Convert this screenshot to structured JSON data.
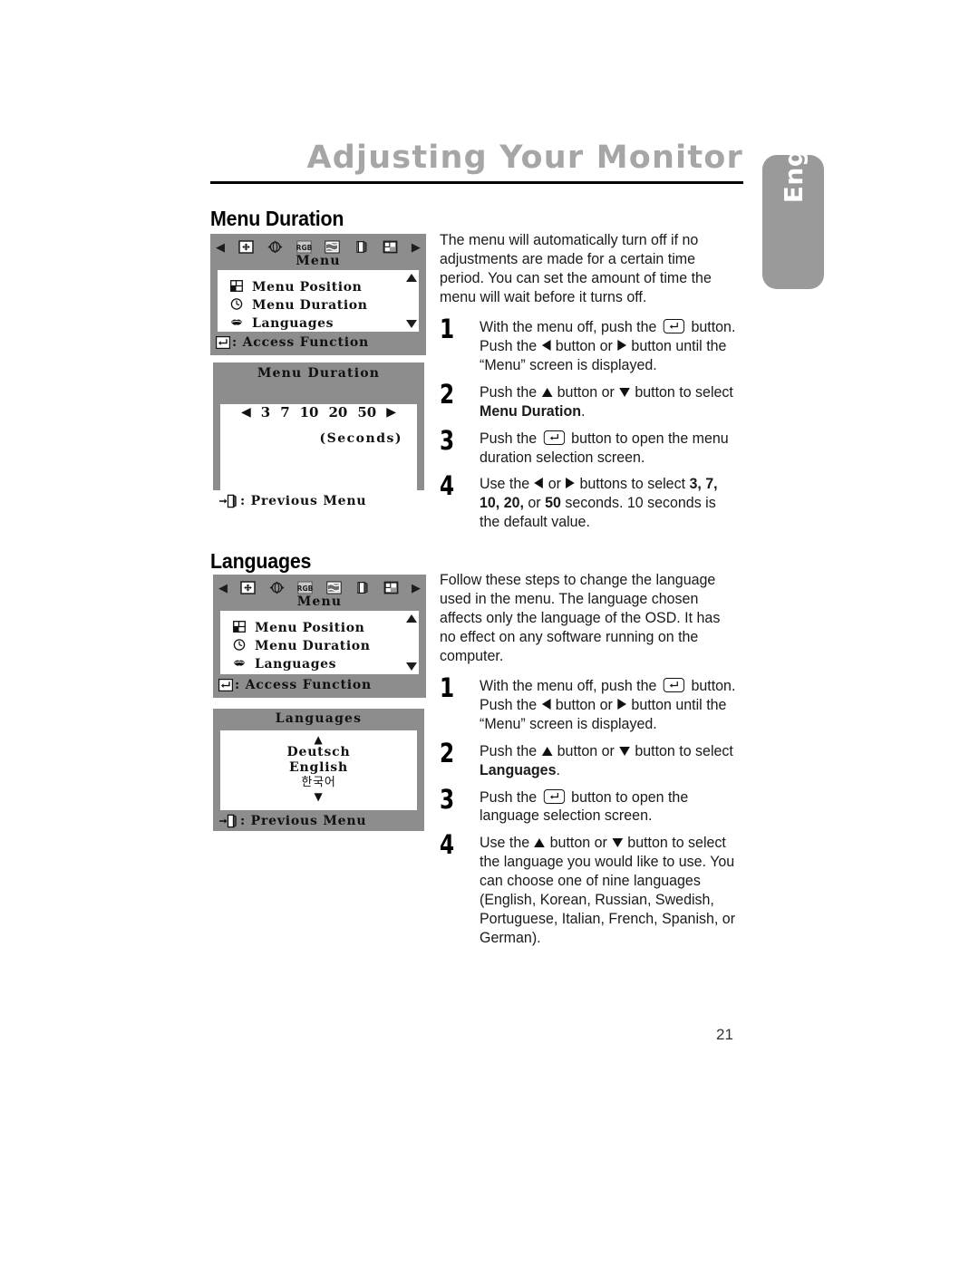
{
  "page": {
    "title": "Adjusting Your Monitor",
    "side_tab": "English",
    "number": "21"
  },
  "sections": [
    {
      "heading": "Menu Duration",
      "intro": "The menu will automatically turn off if no adjustments are made for a certain time period. You can set the amount of time the menu will wait before it turns off.",
      "steps": [
        {
          "num": "1",
          "text_parts": [
            "With the menu off, push the ",
            "ENTER",
            " button. Push the ",
            "LEFT",
            " button or ",
            "RIGHT",
            " button until the “Menu” screen is displayed."
          ]
        },
        {
          "num": "2",
          "text_parts": [
            "Push the ",
            "UP",
            " button or ",
            "DOWN",
            " button to select ",
            "BOLD:Menu Duration",
            "."
          ]
        },
        {
          "num": "3",
          "text_parts": [
            "Push the ",
            "ENTER",
            " button to open the menu duration selection screen."
          ]
        },
        {
          "num": "4",
          "text_parts": [
            "Use the ",
            "LEFT",
            " or ",
            "RIGHT",
            " buttons to select ",
            "BOLD:3, 7, 10, 20,",
            " or ",
            "BOLD:50",
            " seconds. 10 seconds is the default value."
          ]
        }
      ]
    },
    {
      "heading": "Languages",
      "intro": "Follow these steps to change the language used in the menu. The language chosen affects only the language of the OSD. It has no effect on any software running on the computer.",
      "steps": [
        {
          "num": "1",
          "text_parts": [
            "With the menu off, push the ",
            "ENTER",
            " button. Push the ",
            "LEFT",
            " button or ",
            "RIGHT",
            " button until the “Menu” screen is displayed."
          ]
        },
        {
          "num": "2",
          "text_parts": [
            "Push the ",
            "UP",
            " button or ",
            "DOWN",
            " button to select ",
            "BOLD:Languages",
            "."
          ]
        },
        {
          "num": "3",
          "text_parts": [
            "Push the ",
            "ENTER",
            " button to open the language selection screen."
          ]
        },
        {
          "num": "4",
          "text_parts": [
            "Use the ",
            "UP",
            " button or ",
            "DOWN",
            " button to select the language you would like to use. You can choose one of nine languages (English, Korean, Russian, Swedish, Portuguese, Italian, French, Spanish, or German)."
          ]
        }
      ]
    }
  ],
  "osd": {
    "icon_row": [
      "left-arrow-icon",
      "position-icon",
      "geometry-icon",
      "rgb-icon",
      "moire-icon",
      "page-icon",
      "menu-icon",
      "right-arrow-icon"
    ],
    "menu_screen": {
      "title": "Menu",
      "items": [
        {
          "icon": "menu-position-icon",
          "label": "Menu Position"
        },
        {
          "icon": "clock-icon",
          "label": "Menu Duration"
        },
        {
          "icon": "lips-icon",
          "label": "Languages"
        }
      ],
      "footer": ": Access Function",
      "footer_icon": "enter-key-icon"
    },
    "duration_screen": {
      "title": "Menu Duration",
      "values": [
        "3",
        "7",
        "10",
        "20",
        "50"
      ],
      "units": "(Seconds)",
      "footer": ": Previous Menu",
      "footer_icon": "exit-door-icon"
    },
    "languages_screen": {
      "title": "Languages",
      "items": [
        "Deutsch",
        "English",
        "한국어"
      ],
      "footer": ": Previous Menu",
      "footer_icon": "exit-door-icon"
    }
  },
  "colors": {
    "title_gray": "#a6a6a6",
    "osd_gray": "#8d8d8d",
    "tab_gray": "#9a9a9a"
  }
}
